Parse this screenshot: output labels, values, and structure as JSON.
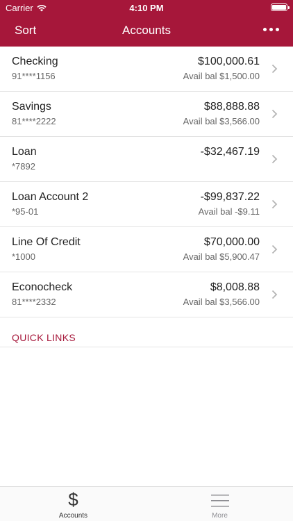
{
  "status_bar": {
    "carrier": "Carrier",
    "time": "4:10 PM"
  },
  "navbar": {
    "left_label": "Sort",
    "title": "Accounts",
    "more_icon": "ellipsis-icon"
  },
  "accounts": [
    {
      "name": "Checking",
      "number": "91****1156",
      "balance": "$100,000.61",
      "available": "Avail bal $1,500.00"
    },
    {
      "name": "Savings",
      "number": "81****2222",
      "balance": "$88,888.88",
      "available": "Avail bal $3,566.00"
    },
    {
      "name": "Loan",
      "number": "*7892",
      "balance": "-$32,467.19",
      "available": ""
    },
    {
      "name": "Loan Account 2",
      "number": "*95-01",
      "balance": "-$99,837.22",
      "available": "Avail bal -$9.11"
    },
    {
      "name": "Line Of Credit",
      "number": "*1000",
      "balance": "$70,000.00",
      "available": "Avail bal $5,900.47"
    },
    {
      "name": "Econocheck",
      "number": "81****2332",
      "balance": "$8,008.88",
      "available": "Avail bal $3,566.00"
    }
  ],
  "quick_links": {
    "label": "QUICK LINKS"
  },
  "tabbar": {
    "accounts_label": "Accounts",
    "accounts_icon": "dollar-icon",
    "accounts_glyph": "$",
    "more_label": "More",
    "more_icon": "hamburger-icon"
  },
  "colors": {
    "brand": "#a6173a",
    "text": "#222222",
    "muted": "#666666",
    "divider": "#e3e3e3"
  }
}
